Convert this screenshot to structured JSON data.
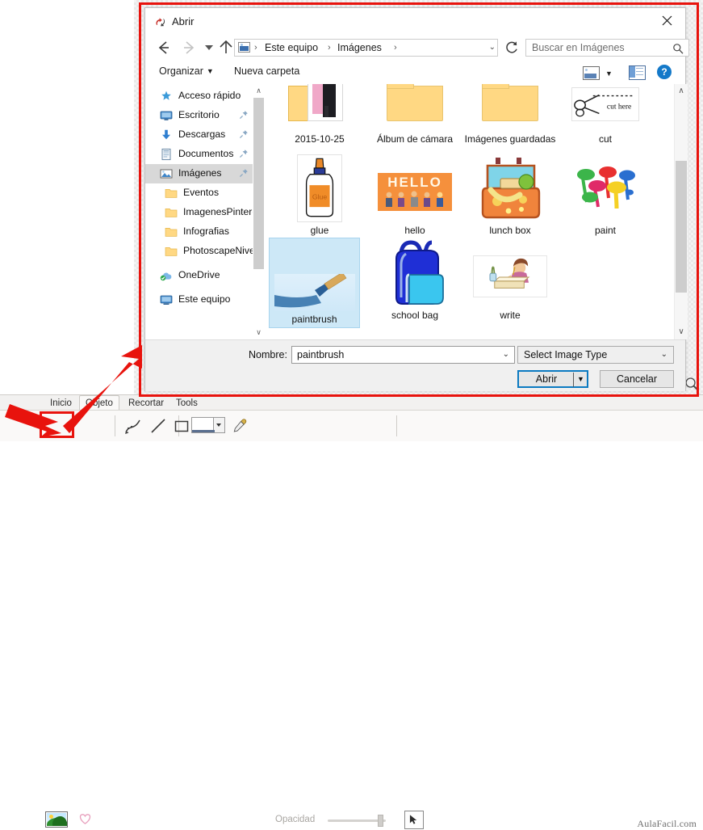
{
  "dialog": {
    "title": "Abrir",
    "title_icon": "open-folder-icon",
    "close_label": "✕",
    "nav": {
      "back_icon": "back-arrow-icon",
      "forward_icon": "forward-arrow-icon",
      "recent_icon": "recent-locations-icon",
      "up_icon": "up-arrow-icon",
      "breadcrumb": [
        "Este equipo",
        "Imágenes"
      ],
      "breadcrumb_separator": "›",
      "breadcrumb_dropdown": "⌄",
      "refresh_icon": "refresh-icon",
      "location_icon": "pictures-library-icon"
    },
    "search": {
      "placeholder": "Buscar en Imágenes",
      "value": "",
      "icon": "search-icon"
    },
    "commandbar": {
      "organize_label": "Organizar",
      "organize_caret": "▼",
      "new_folder_label": "Nueva carpeta",
      "view_icon": "change-view-icon",
      "view_caret": "▼",
      "preview_pane_icon": "preview-pane-icon",
      "help_icon": "help-icon",
      "help_glyph": "?"
    },
    "sidebar": {
      "items": [
        {
          "label": "Acceso rápido",
          "icon": "star-pin-icon",
          "indent": false,
          "pinned": false,
          "selected": false
        },
        {
          "label": "Escritorio",
          "icon": "desktop-icon",
          "indent": false,
          "pinned": true,
          "selected": false
        },
        {
          "label": "Descargas",
          "icon": "downloads-icon",
          "indent": false,
          "pinned": true,
          "selected": false
        },
        {
          "label": "Documentos",
          "icon": "documents-icon",
          "indent": false,
          "pinned": true,
          "selected": false
        },
        {
          "label": "Imágenes",
          "icon": "pictures-icon",
          "indent": false,
          "pinned": true,
          "selected": true
        },
        {
          "label": "Eventos",
          "icon": "folder-icon",
          "indent": true,
          "pinned": false,
          "selected": false
        },
        {
          "label": "ImagenesPintere",
          "icon": "folder-icon",
          "indent": true,
          "pinned": false,
          "selected": false
        },
        {
          "label": "Infografias",
          "icon": "folder-icon",
          "indent": true,
          "pinned": false,
          "selected": false
        },
        {
          "label": "PhotoscapeNive",
          "icon": "folder-icon",
          "indent": true,
          "pinned": false,
          "selected": false
        },
        {
          "label": "OneDrive",
          "icon": "onedrive-icon",
          "indent": false,
          "pinned": false,
          "selected": false
        },
        {
          "label": "Este equipo",
          "icon": "this-pc-icon",
          "indent": false,
          "pinned": false,
          "selected": false
        }
      ],
      "scroll_up": "∧",
      "scroll_down": "∨"
    },
    "files": {
      "scroll_up": "∧",
      "scroll_down": "∨",
      "items": [
        {
          "name": "2015-10-25",
          "kind": "folder-photo",
          "selected": false
        },
        {
          "name": "Álbum de cámara",
          "kind": "folder",
          "selected": false
        },
        {
          "name": "Imágenes guardadas",
          "kind": "folder",
          "selected": false
        },
        {
          "name": "cut",
          "kind": "image-cut",
          "selected": false
        },
        {
          "name": "glue",
          "kind": "image-glue",
          "selected": false
        },
        {
          "name": "hello",
          "kind": "image-hello",
          "selected": false
        },
        {
          "name": "lunch box",
          "kind": "image-lunchbox",
          "selected": false
        },
        {
          "name": "paint",
          "kind": "image-paint",
          "selected": false
        },
        {
          "name": "paintbrush",
          "kind": "image-paintbrush",
          "selected": true
        },
        {
          "name": "school bag",
          "kind": "image-schoolbag",
          "selected": false
        },
        {
          "name": "write",
          "kind": "image-write",
          "selected": false
        }
      ]
    },
    "footer": {
      "filename_label": "Nombre:",
      "filename_value": "paintbrush",
      "filename_caret": "⌄",
      "filetype_value": "Select Image Type",
      "filetype_caret": "⌄",
      "open_label": "Abrir",
      "open_caret": "▼",
      "cancel_label": "Cancelar"
    }
  },
  "app": {
    "tabs": [
      {
        "label": "Inicio",
        "active": false
      },
      {
        "label": "Objeto",
        "active": true
      },
      {
        "label": "Recortar",
        "active": false
      },
      {
        "label": "Tools",
        "active": false
      }
    ],
    "tools": [
      {
        "name": "image-tool",
        "highlighted": true
      },
      {
        "name": "heart-shape-tool",
        "highlighted": false
      },
      {
        "name": "curve-tool",
        "highlighted": false
      },
      {
        "name": "line-tool",
        "highlighted": false
      },
      {
        "name": "rectangle-tool",
        "highlighted": false
      },
      {
        "name": "color-dropdown",
        "highlighted": false
      },
      {
        "name": "eyedropper-tool",
        "highlighted": false
      }
    ],
    "opacity_label": "Opacidad",
    "pointer_tool": "pointer-tool",
    "watermark": "AulaFacil.com",
    "magnifier_icon": "magnifier-icon"
  },
  "annotations": {
    "highlight_color": "#e8130d",
    "frame": "red-frame-around-dialog",
    "arrows": [
      "arrow-to-dialog",
      "arrow-to-image-tool"
    ]
  }
}
